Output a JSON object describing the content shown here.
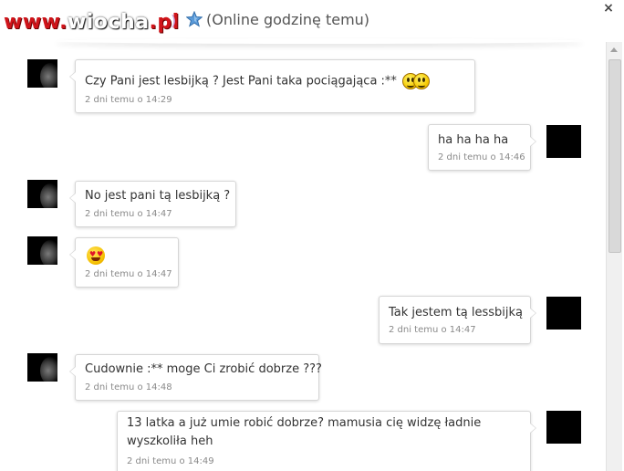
{
  "header": {
    "watermark_a": "www.",
    "watermark_b": "wiocha",
    "watermark_c": ".pl",
    "paren_mark": ")",
    "status_icon": "star-icon",
    "status_text": "(Online godzinę temu)",
    "close_label": "×"
  },
  "messages": [
    {
      "side": "left",
      "text": "Czy Pani jest lesbijką ? Jest Pani taka pociągająca :**",
      "emoji": "blushing-faces-icon",
      "time": "2 dni temu o 14:29"
    },
    {
      "side": "right",
      "text": "ha ha ha ha",
      "time": "2 dni temu o 14:46"
    },
    {
      "side": "left",
      "text": "No jest pani tą lesbijką ?",
      "time": "2 dni temu o 14:47"
    },
    {
      "side": "left",
      "text": "",
      "emoji": "heart-eyes-icon",
      "time": "2 dni temu o 14:47"
    },
    {
      "side": "right",
      "text": "Tak jestem tą lessbijką",
      "time": "2 dni temu o 14:47"
    },
    {
      "side": "left",
      "text": "Cudownie :** moge Ci zrobić dobrze ???",
      "time": "2 dni temu o 14:48"
    },
    {
      "side": "right",
      "text": "13 latka a już umie robić dobrze? mamusia cię widzę ładnie wyszkoliła heh",
      "time": "2 dni temu o 14:49"
    }
  ],
  "colors": {
    "watermark": "#d0141a",
    "text": "#333333",
    "timestamp": "#8a8a8a",
    "bubble_border": "#d6d6d6",
    "star": "#5a9ad8"
  }
}
